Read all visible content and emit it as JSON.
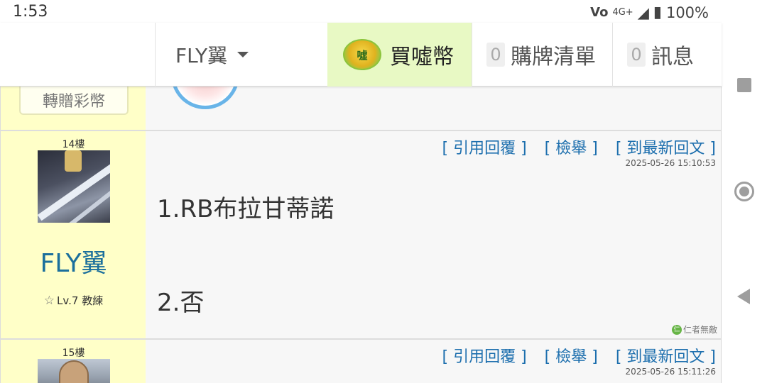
{
  "status_bar": {
    "time": "1:53",
    "network": "4G+",
    "battery": "100%",
    "icons": [
      "volte-icon",
      "signal-icon",
      "battery-icon"
    ]
  },
  "nav": {
    "username": "FLY翼",
    "buy_label": "買噓幣",
    "coin_text": "噓",
    "cart_count": "0",
    "cart_label": "購牌清單",
    "msg_count": "0",
    "msg_label": "訊息"
  },
  "prev_post": {
    "gift_button": "轉贈彩幣"
  },
  "posts": [
    {
      "floor": "14樓",
      "username": "FLY翼",
      "level": "Lv.7 教練",
      "actions": [
        "引用回覆",
        "檢舉",
        "到最新回文"
      ],
      "timestamp": "2025-05-26 15:10:53",
      "lines": [
        "1.RB布拉甘蒂諾",
        "2.否"
      ],
      "signature": "仁者無敵",
      "signature_icon": "仁"
    },
    {
      "floor": "15樓",
      "actions": [
        "引用回覆",
        "檢舉",
        "到最新回文"
      ],
      "timestamp": "2025-05-26 15:11:26"
    }
  ],
  "colors": {
    "accent_blue": "#1d6fae",
    "username_blue": "#1b6f9c",
    "user_panel_bg": "#ffffc8",
    "buy_bg": "#e8f9c4"
  }
}
